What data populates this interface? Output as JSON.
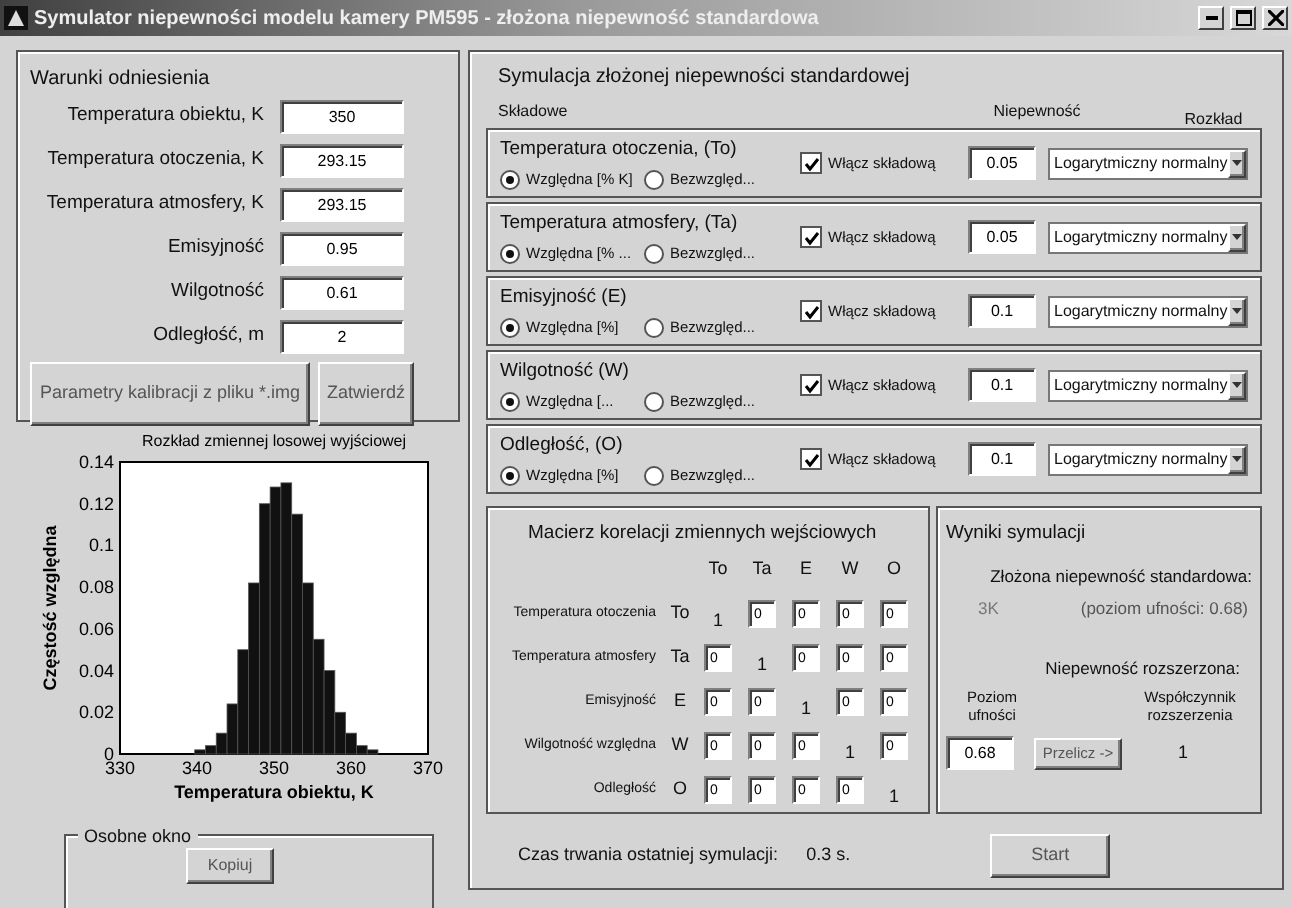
{
  "window": {
    "title": "Symulator niepewności modelu kamery PM595 - złożona niepewność standardowa"
  },
  "reference": {
    "title": "Warunki odniesienia",
    "fields": [
      {
        "label": "Temperatura obiektu, K",
        "value": "350"
      },
      {
        "label": "Temperatura otoczenia, K",
        "value": "293.15"
      },
      {
        "label": "Temperatura atmosfery, K",
        "value": "293.15"
      },
      {
        "label": "Emisyjność",
        "value": "0.95"
      },
      {
        "label": "Wilgotność",
        "value": "0.61"
      },
      {
        "label": "Odległość, m",
        "value": "2"
      }
    ],
    "buttons": [
      "Parametry kalibracji z pliku *.img",
      "Zatwierdź"
    ]
  },
  "histogram": {
    "chart_data": {
      "type": "bar",
      "title": "Rozkład zmiennej losowej wyjściowej",
      "xlabel": "Temperatura obiektu, K",
      "ylabel": "Częstość względna",
      "x": [
        340.4,
        341.8,
        343.2,
        344.6,
        346.0,
        347.4,
        348.8,
        350.2,
        351.6,
        353.0,
        354.4,
        355.8,
        357.2,
        358.6,
        360.0,
        361.4,
        362.8
      ],
      "values": [
        0.002,
        0.004,
        0.01,
        0.024,
        0.05,
        0.082,
        0.12,
        0.128,
        0.13,
        0.115,
        0.082,
        0.055,
        0.04,
        0.02,
        0.01,
        0.004,
        0.002
      ],
      "xlim": [
        330,
        370
      ],
      "ylim": [
        0,
        0.14
      ],
      "xticks": [
        330,
        340,
        350,
        360,
        370
      ],
      "yticks": [
        0,
        0.02,
        0.04,
        0.06,
        0.08,
        0.1,
        0.12,
        0.14
      ]
    }
  },
  "separate_window": {
    "title": "Osobne okno",
    "button": "Kopiuj"
  },
  "simulation": {
    "title": "Symulacja złożonej niepewności standardowej",
    "headers": [
      "Składowe",
      "Niepewność",
      "Rozkład"
    ],
    "components": [
      {
        "name": "Temperatura otoczenia, (To)",
        "options": [
          {
            "label": "Względna [% K]",
            "selected": true
          },
          {
            "label": "Bezwzględ...",
            "selected": false
          }
        ],
        "enable_label": "Włącz składową",
        "checked": true,
        "uncertainty": "0.05",
        "distribution": "Logarytmiczny normalny"
      },
      {
        "name": "Temperatura atmosfery, (Ta)",
        "options": [
          {
            "label": "Względna [% ...",
            "selected": true
          },
          {
            "label": "Bezwzględ...",
            "selected": false
          }
        ],
        "enable_label": "Włącz składową",
        "checked": true,
        "uncertainty": "0.05",
        "distribution": "Logarytmiczny normalny"
      },
      {
        "name": "Emisyjność (E)",
        "options": [
          {
            "label": "Względna [%]",
            "selected": true
          },
          {
            "label": "Bezwzględ...",
            "selected": false
          }
        ],
        "enable_label": "Włącz składową",
        "checked": true,
        "uncertainty": "0.1",
        "distribution": "Logarytmiczny normalny"
      },
      {
        "name": "Wilgotność (W)",
        "options": [
          {
            "label": "Względna [...",
            "selected": true
          },
          {
            "label": "Bezwzględ...",
            "selected": false
          }
        ],
        "enable_label": "Włącz składową",
        "checked": true,
        "uncertainty": "0.1",
        "distribution": "Logarytmiczny normalny"
      },
      {
        "name": "Odległość, (O)",
        "options": [
          {
            "label": "Względna [%]",
            "selected": true
          },
          {
            "label": "Bezwzględ...",
            "selected": false
          }
        ],
        "enable_label": "Włącz składową",
        "checked": true,
        "uncertainty": "0.1",
        "distribution": "Logarytmiczny normalny"
      }
    ]
  },
  "correlation": {
    "title": "Macierz korelacji zmiennych wejściowych",
    "columns": [
      "To",
      "Ta",
      "E",
      "W",
      "O"
    ],
    "rows": [
      {
        "label": "Temperatura otoczenia",
        "code": "To",
        "cells": [
          {
            "kind": "value",
            "text": "1"
          },
          {
            "kind": "input",
            "text": "0"
          },
          {
            "kind": "input",
            "text": "0"
          },
          {
            "kind": "input",
            "text": "0"
          },
          {
            "kind": "input",
            "text": "0"
          }
        ]
      },
      {
        "label": "Temperatura atmosfery",
        "code": "Ta",
        "cells": [
          {
            "kind": "input",
            "text": "0"
          },
          {
            "kind": "value",
            "text": "1"
          },
          {
            "kind": "input",
            "text": "0"
          },
          {
            "kind": "input",
            "text": "0"
          },
          {
            "kind": "input",
            "text": "0"
          }
        ]
      },
      {
        "label": "Emisyjność",
        "code": "E",
        "cells": [
          {
            "kind": "input",
            "text": "0"
          },
          {
            "kind": "input",
            "text": "0"
          },
          {
            "kind": "value",
            "text": "1"
          },
          {
            "kind": "input",
            "text": "0"
          },
          {
            "kind": "input",
            "text": "0"
          }
        ]
      },
      {
        "label": "Wilgotność względna",
        "code": "W",
        "cells": [
          {
            "kind": "input",
            "text": "0"
          },
          {
            "kind": "input",
            "text": "0"
          },
          {
            "kind": "input",
            "text": "0"
          },
          {
            "kind": "value",
            "text": "1"
          },
          {
            "kind": "input",
            "text": "0"
          }
        ]
      },
      {
        "label": "Odległość",
        "code": "O",
        "cells": [
          {
            "kind": "input",
            "text": "0"
          },
          {
            "kind": "input",
            "text": "0"
          },
          {
            "kind": "input",
            "text": "0"
          },
          {
            "kind": "input",
            "text": "0"
          },
          {
            "kind": "value",
            "text": "1"
          }
        ]
      }
    ]
  },
  "results": {
    "title": "Wyniki symulacji",
    "combined_label": "Złożona niepewność standardowa:",
    "combined_value": "3K",
    "combined_level": "(poziom ufności: 0.68)",
    "expanded_label": "Niepewność rozszerzona:",
    "level_label": "Poziom ufności",
    "factor_label": "Współczynnik rozszerzenia",
    "level_value": "0.68",
    "recalc_button": "Przelicz ->",
    "factor_value": "1"
  },
  "status": {
    "label": "Czas trwania ostatniej symulacji:",
    "value": "0.3 s.",
    "start_button": "Start"
  }
}
